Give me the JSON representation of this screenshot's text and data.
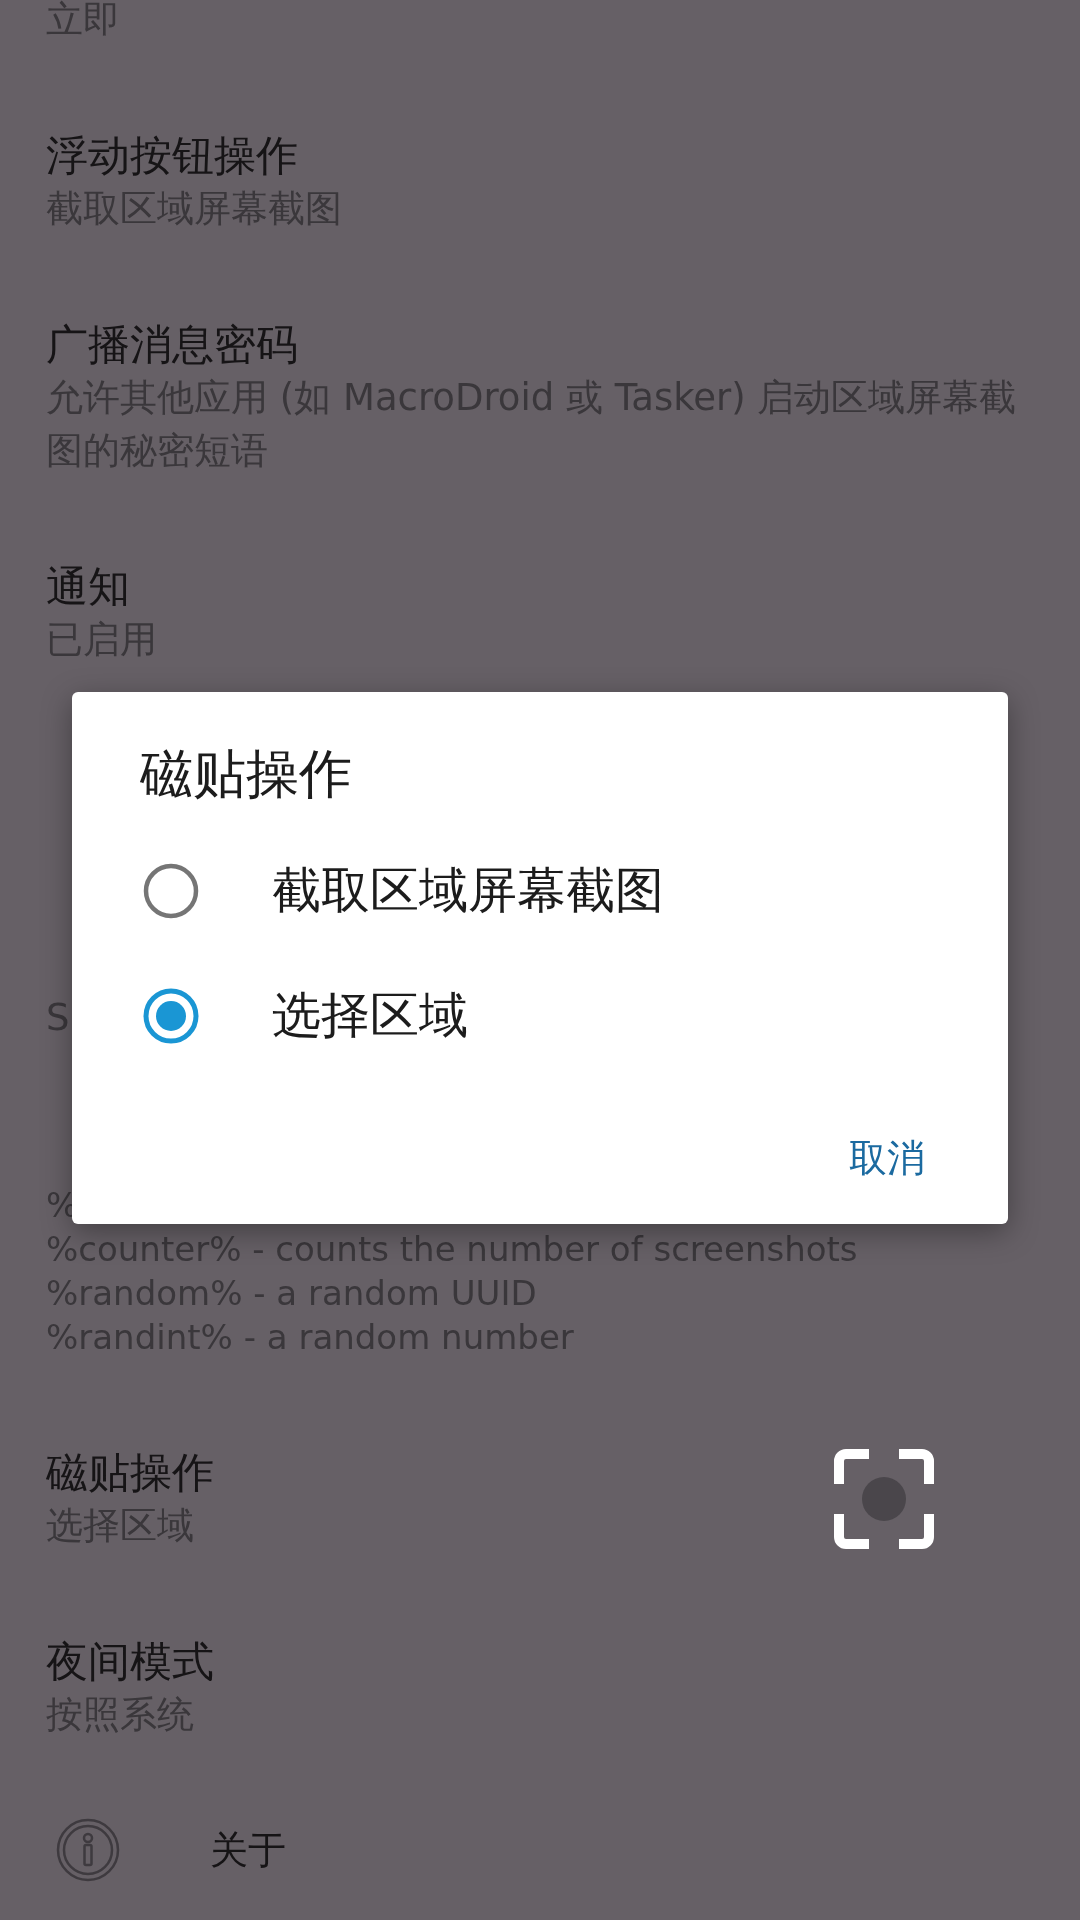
{
  "settings": [
    {
      "kind": "setting",
      "summary": [
        "立即"
      ]
    },
    {
      "kind": "setting",
      "title": "浮动按钮操作",
      "summary": [
        "截取区域屏幕截图"
      ]
    },
    {
      "kind": "setting",
      "title": "广播消息密码",
      "summary": [
        "允许其他应用 (如 MacroDroid 或 Tasker) 启动区域屏幕截",
        "图的秘密短语"
      ]
    },
    {
      "kind": "setting",
      "title": "通知",
      "summary": [
        "已启用"
      ]
    },
    {
      "kind": "covered"
    },
    {
      "kind": "covered",
      "summary": [
        "S"
      ]
    },
    {
      "kind": "note",
      "lines": [
        "%",
        "%counter% - counts the number of screenshots",
        "%random% - a random UUID",
        "%randint% - a random number"
      ]
    },
    {
      "kind": "tile",
      "title": "磁贴操作",
      "summary": [
        "选择区域"
      ]
    },
    {
      "kind": "setting",
      "title": "夜间模式",
      "summary": [
        "按照系统"
      ]
    },
    {
      "kind": "link",
      "label": "关于"
    }
  ],
  "dialog": {
    "title": "磁贴操作",
    "options": [
      {
        "label": "截取区域屏幕截图",
        "selected": false
      },
      {
        "label": "选择区域",
        "selected": true
      }
    ],
    "buttons": [
      "取消"
    ]
  }
}
